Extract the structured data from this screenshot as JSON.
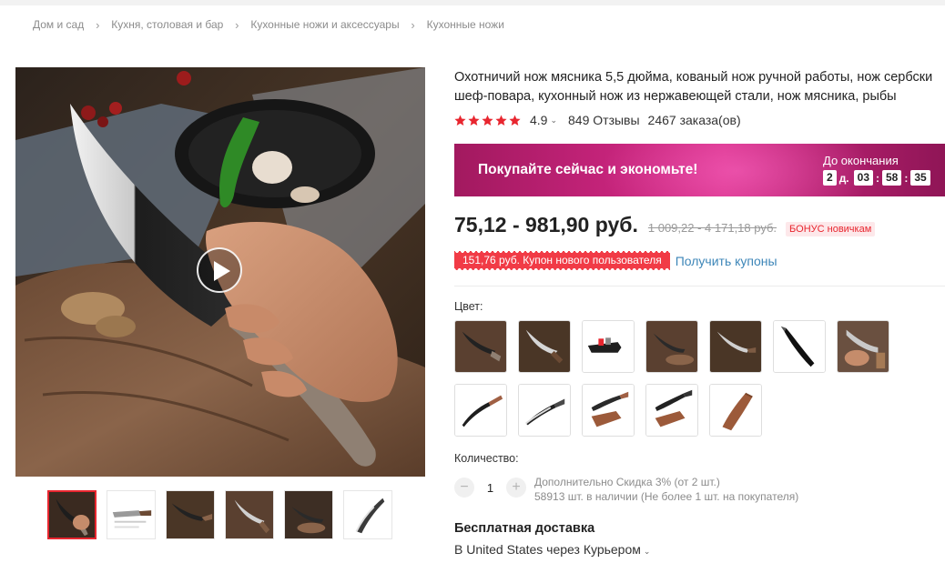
{
  "breadcrumb": [
    "Дом и сад",
    "Кухня, столовая и бар",
    "Кухонные ножи и аксессуары",
    "Кухонные ножи"
  ],
  "product": {
    "title_line1": "Охотничий нож мясника 5,5 дюйма, кованый нож ручной работы, нож сербски",
    "title_line2": "шеф-повара, кухонный нож из нержавеющей стали, нож мясника, рыбы",
    "rating": "4.9",
    "stars": 5,
    "reviews": "849 Отзывы",
    "orders": "2467 заказа(ов)"
  },
  "promo": {
    "text": "Покупайте сейчас и экономьте!",
    "ends_label": "До окончания",
    "days": "2",
    "days_unit": "д.",
    "hours": "03",
    "minutes": "58",
    "seconds": "35"
  },
  "price": {
    "current": "75,12 - 981,90 руб.",
    "old": "1 009,22 - 4 171,18 руб.",
    "bonus": "БОНУС новичкам"
  },
  "coupon": {
    "text": "151,76 руб. Купон нового пользователя",
    "link": "Получить купоны"
  },
  "color_label": "Цвет:",
  "swatch_count": 12,
  "quantity": {
    "label": "Количество:",
    "value": "1",
    "minus": "−",
    "plus": "+",
    "discount": "Дополнительно Скидка 3% (от 2 шт.)",
    "stock": "58913 шт. в наличии (Не более 1 шт. на покупателя)"
  },
  "shipping": {
    "title": "Бесплатная доставка",
    "destination": "В United States через Курьером"
  },
  "colors": {
    "accent": "#e8262f",
    "link": "#3d86b8",
    "promo": "#c32379"
  }
}
